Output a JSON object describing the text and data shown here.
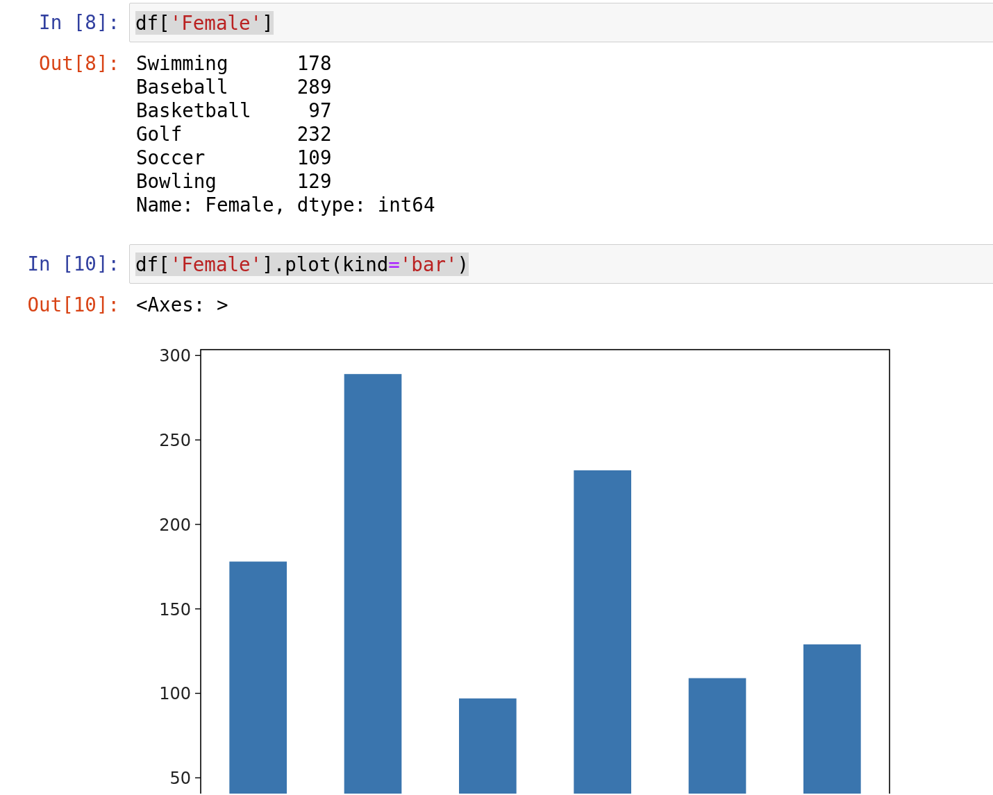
{
  "cells": [
    {
      "kind": "code",
      "prompt": "In [8]:",
      "tokens": [
        {
          "kind": "plain",
          "text": "df["
        },
        {
          "kind": "string",
          "text": "'Female'"
        },
        {
          "kind": "plain",
          "text": "]"
        }
      ]
    },
    {
      "kind": "text_output",
      "prompt": "Out[8]:",
      "lines": [
        "Swimming      178",
        "Baseball      289",
        "Basketball     97",
        "Golf          232",
        "Soccer        109",
        "Bowling       129",
        "Name: Female, dtype: int64"
      ]
    },
    {
      "kind": "code",
      "prompt": "In [10]:",
      "tokens": [
        {
          "kind": "plain",
          "text": "df["
        },
        {
          "kind": "string",
          "text": "'Female'"
        },
        {
          "kind": "plain",
          "text": "].plot(kind"
        },
        {
          "kind": "operator",
          "text": "="
        },
        {
          "kind": "string",
          "text": "'bar'"
        },
        {
          "kind": "plain",
          "text": ")"
        }
      ]
    },
    {
      "kind": "text_output",
      "prompt": "Out[10]:",
      "lines": [
        "<Axes: >"
      ]
    },
    {
      "kind": "chart_output",
      "chart_data": {
        "type": "bar",
        "series": [
          {
            "color": "#3a75ae",
            "values": [
              178,
              289,
              97,
              232,
              109,
              129
            ]
          }
        ],
        "ylim": [
          0,
          303.45
        ],
        "yticks": [
          50,
          100,
          150,
          200,
          250,
          300
        ]
      }
    }
  ]
}
